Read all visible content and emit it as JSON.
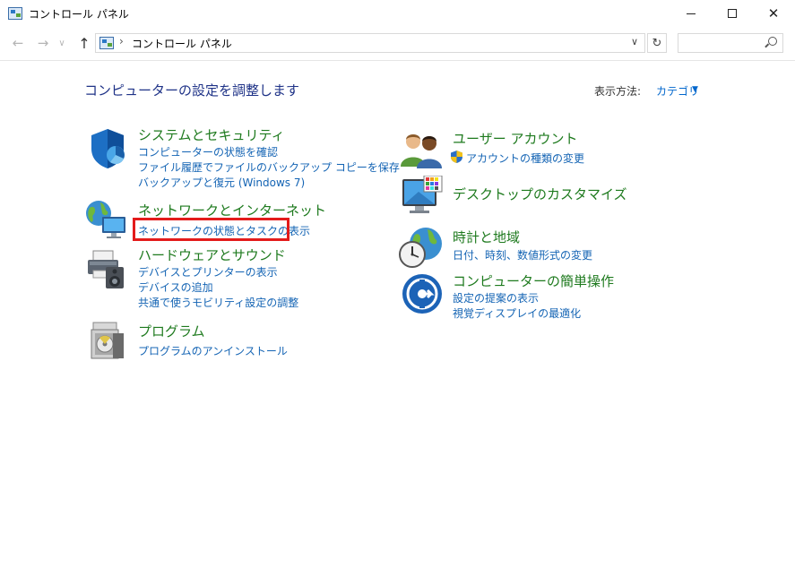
{
  "window": {
    "title": "コントロール パネル"
  },
  "address": {
    "crumb": "コントロール パネル",
    "sep1": "›",
    "sep2": "›",
    "dropdown_glyph": "∨",
    "refresh_glyph": "↻"
  },
  "nav": {
    "back": "←",
    "forward": "→",
    "recent": "∨",
    "up": "↑"
  },
  "window_controls": {
    "close": "✕"
  },
  "main": {
    "title": "コンピューターの設定を調整します",
    "view_label": "表示方法:",
    "view_value": "カテゴリ",
    "view_caret": "▼"
  },
  "categories_left": [
    {
      "title": "システムとセキュリティ",
      "links": [
        "コンピューターの状態を確認",
        "ファイル履歴でファイルのバックアップ コピーを保存",
        "バックアップと復元 (Windows 7)"
      ],
      "icon": "shield-icon"
    },
    {
      "title": "ネットワークとインターネット",
      "links": [
        "ネットワークの状態とタスクの表示"
      ],
      "icon": "network-globe-icon"
    },
    {
      "title": "ハードウェアとサウンド",
      "links": [
        "デバイスとプリンターの表示",
        "デバイスの追加",
        "共通で使うモビリティ設定の調整"
      ],
      "icon": "printer-speaker-icon"
    },
    {
      "title": "プログラム",
      "links": [
        "プログラムのアンインストール"
      ],
      "icon": "programs-disc-icon"
    }
  ],
  "categories_right": [
    {
      "title": "ユーザー アカウント",
      "links": [
        "アカウントの種類の変更"
      ],
      "icon": "users-icon"
    },
    {
      "title": "デスクトップのカスタマイズ",
      "links": [],
      "icon": "monitor-palette-icon"
    },
    {
      "title": "時計と地域",
      "links": [
        "日付、時刻、数値形式の変更"
      ],
      "icon": "clock-globe-icon"
    },
    {
      "title": "コンピューターの簡単操作",
      "links": [
        "設定の提案の表示",
        "視覚ディスプレイの最適化"
      ],
      "icon": "ease-of-access-icon"
    }
  ],
  "colors": {
    "category_title": "#1e7a1e",
    "link": "#1464b4",
    "page_title": "#1e3287",
    "highlight_border": "#e31b1b"
  }
}
